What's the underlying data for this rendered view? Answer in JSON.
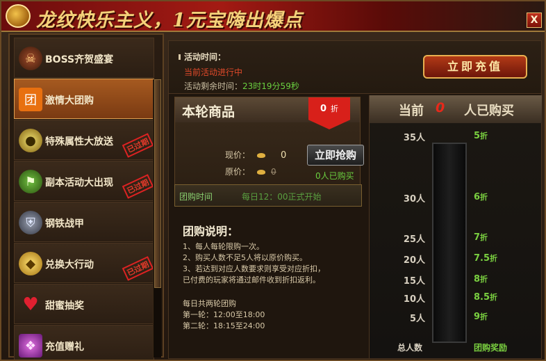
{
  "banner": {
    "title": "龙纹快乐主义，1元宝嗨出爆点",
    "close_label": "X"
  },
  "sidebar": {
    "items": [
      {
        "label": "BOSS齐贺盛宴",
        "icon": "boss-icon",
        "stamp": ""
      },
      {
        "label": "激情大团购",
        "icon": "group-buy-icon",
        "stamp": ""
      },
      {
        "label": "特殊属性大放送",
        "icon": "attribute-orb-icon",
        "stamp": "已过期"
      },
      {
        "label": "副本活动大出现",
        "icon": "dungeon-icon",
        "stamp": "已过期"
      },
      {
        "label": "钢铁战甲",
        "icon": "armor-icon",
        "stamp": ""
      },
      {
        "label": "兑换大行动",
        "icon": "gold-ingot-icon",
        "stamp": "已过期"
      },
      {
        "label": "甜蜜抽奖",
        "icon": "heart-icon",
        "stamp": ""
      },
      {
        "label": "充值赠礼",
        "icon": "gift-box-icon",
        "stamp": ""
      }
    ]
  },
  "info": {
    "time_label": "活动时间：",
    "status": "当前活动进行中",
    "remaining_label": "活动剩余时间：",
    "remaining": "23时19分59秒",
    "recharge_label": "立即充值"
  },
  "goods": {
    "title": "本轮商品",
    "discount": "0",
    "discount_unit": "折",
    "now_label": "现价：",
    "now_value": "0",
    "old_label": "原价：",
    "old_value": "0",
    "buy_label": "立即抢购",
    "bought": "0人已购买"
  },
  "buy_time": {
    "label": "团购时间",
    "value": "每日12：00正式开始"
  },
  "description": {
    "title": "团购说明：",
    "lines": [
      "1、每人每轮限购一次。",
      "2、购买人数不足5人将以原价购买。",
      "3、若达到对应人数要求则享受对应折扣，",
      "已付费的玩家将通过邮件收到折扣返利。"
    ],
    "schedule_title": "每日共两轮团购",
    "round1": "第一轮：12:00至18:00",
    "round2": "第二轮：18:15至24:00"
  },
  "progress": {
    "head_a": "当前",
    "count": "0",
    "head_b": "人已购买",
    "tiers": [
      {
        "people": "35人",
        "discount": "5",
        "unit": "折"
      },
      {
        "people": "30人",
        "discount": "6",
        "unit": "折"
      },
      {
        "people": "25人",
        "discount": "7",
        "unit": "折"
      },
      {
        "people": "20人",
        "discount": "7.5",
        "unit": "折"
      },
      {
        "people": "15人",
        "discount": "8",
        "unit": "折"
      },
      {
        "people": "10人",
        "discount": "8.5",
        "unit": "折"
      },
      {
        "people": "5人",
        "discount": "9",
        "unit": "折"
      }
    ],
    "foot_left": "总人数",
    "foot_right": "团购奖励",
    "fill_fraction": 0
  }
}
